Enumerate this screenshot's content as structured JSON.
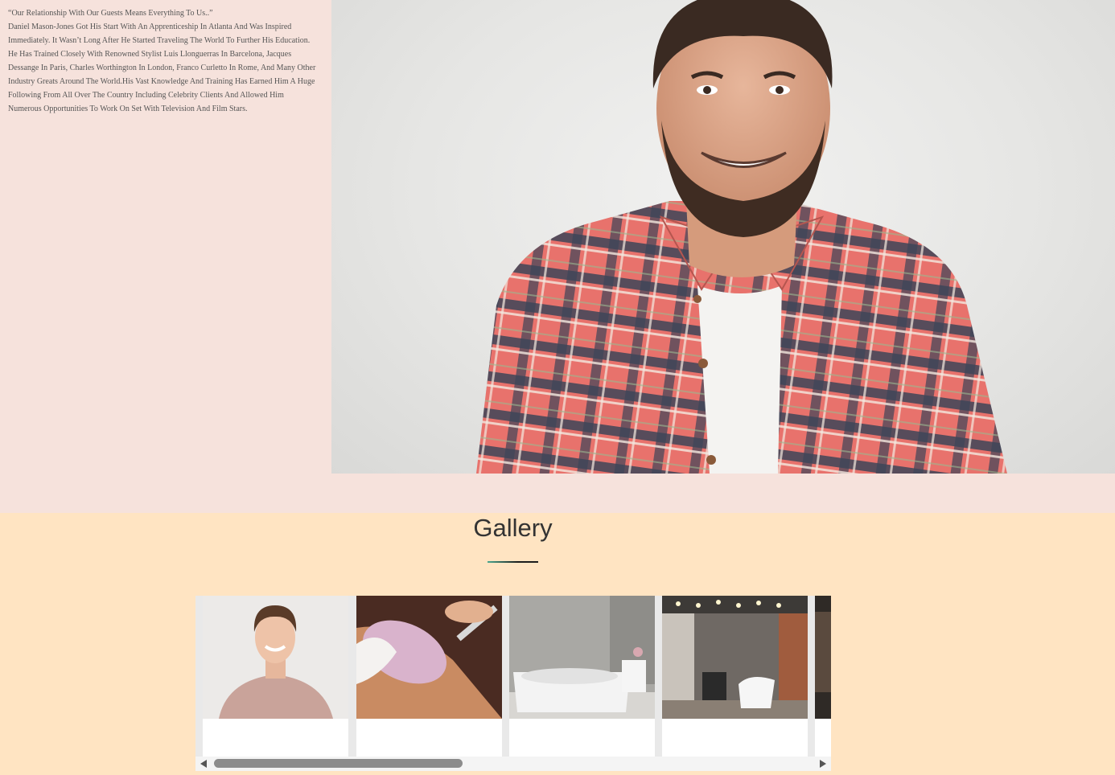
{
  "about": {
    "quote": "“Our Relationship With Our Guests Means Everything To Us..”",
    "bio": "Daniel Mason-Jones Got His Start With An Apprenticeship In Atlanta And Was Inspired Immediately. It Wasn’t Long After He Started Traveling The World To Further His Education. He Has Trained Closely With Renowned Stylist Luis Llonguerras In Barcelona, Jacques Dessange In Paris, Charles Worthington In London, Franco Curletto In Rome, And Many Other Industry Greats Around The World.His Vast Knowledge And Training Has Earned Him A Huge Following From All Over The Country Including Celebrity Clients And Allowed Him Numerous Opportunities To Work On Set With Television And Film Stars."
  },
  "gallery": {
    "title": "Gallery",
    "slides": [
      {
        "icon": "smiling-man-photo"
      },
      {
        "icon": "facial-treatment-photo"
      },
      {
        "icon": "bathtub-photo"
      },
      {
        "icon": "salon-interior-photo"
      },
      {
        "icon": "salon-dark-photo"
      }
    ]
  },
  "colors": {
    "about_bg": "#f6e2dc",
    "gallery_bg": "#ffe4c2",
    "underline_accent": "#4aa78f"
  }
}
